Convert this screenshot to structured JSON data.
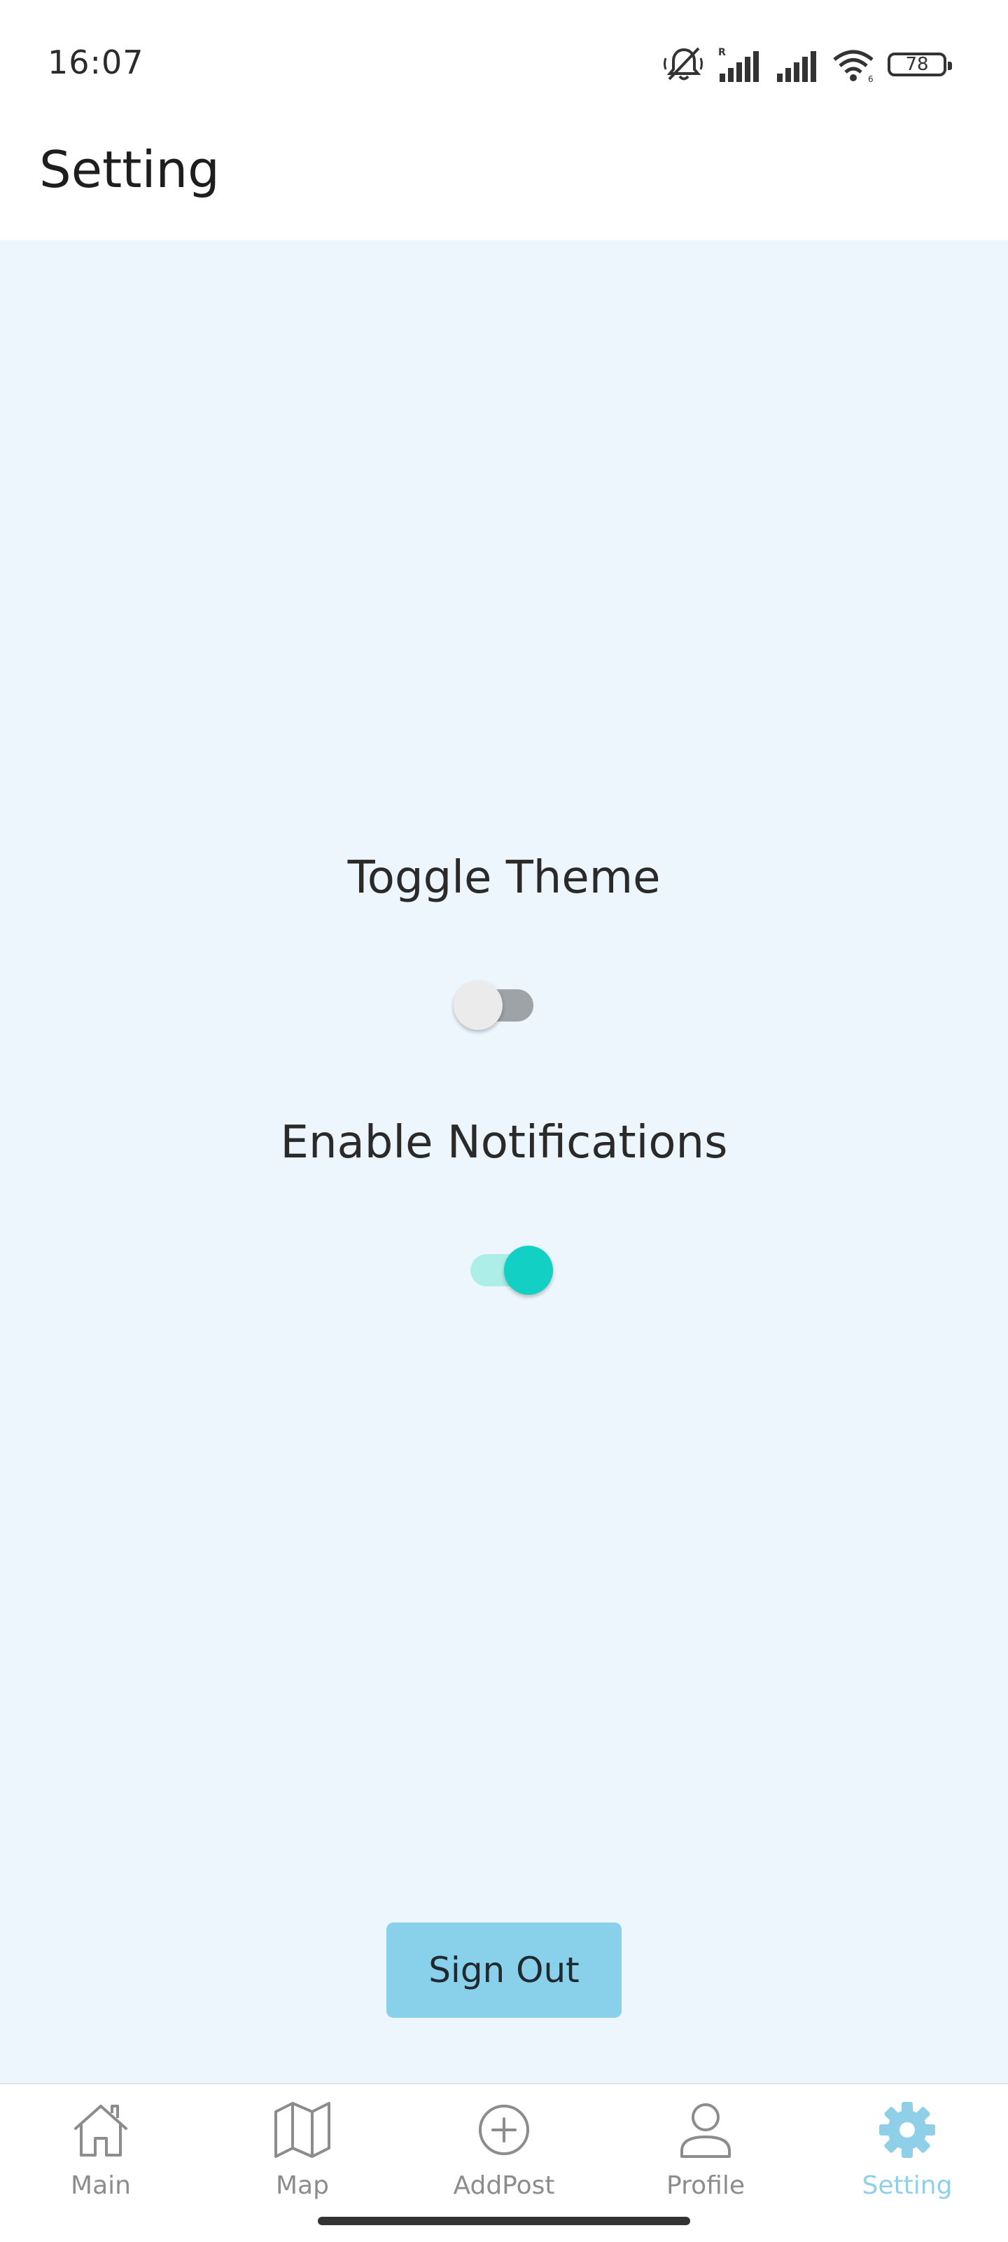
{
  "status_bar": {
    "time": "16:07",
    "battery": "78",
    "icons": [
      "mute-icon",
      "signal-roaming-icon",
      "signal-icon",
      "wifi-icon",
      "battery-icon"
    ]
  },
  "header": {
    "title": "Setting"
  },
  "settings": {
    "theme": {
      "label": "Toggle Theme",
      "enabled": false
    },
    "notifications": {
      "label": "Enable Notifications",
      "enabled": true
    }
  },
  "sign_out_label": "Sign Out",
  "bottom_nav": {
    "active": "Setting",
    "items": [
      {
        "label": "Main",
        "icon": "home-icon"
      },
      {
        "label": "Map",
        "icon": "map-icon"
      },
      {
        "label": "AddPost",
        "icon": "add-circle-icon"
      },
      {
        "label": "Profile",
        "icon": "person-icon"
      },
      {
        "label": "Setting",
        "icon": "gear-icon"
      }
    ]
  },
  "colors": {
    "content_background": "#edf6fd",
    "accent": "#8fd0e8",
    "switch_on": "#12d1c4",
    "switch_on_track": "#aeeee8",
    "switch_off_track": "#9ea3a8",
    "button_background": "#89d0ea"
  }
}
